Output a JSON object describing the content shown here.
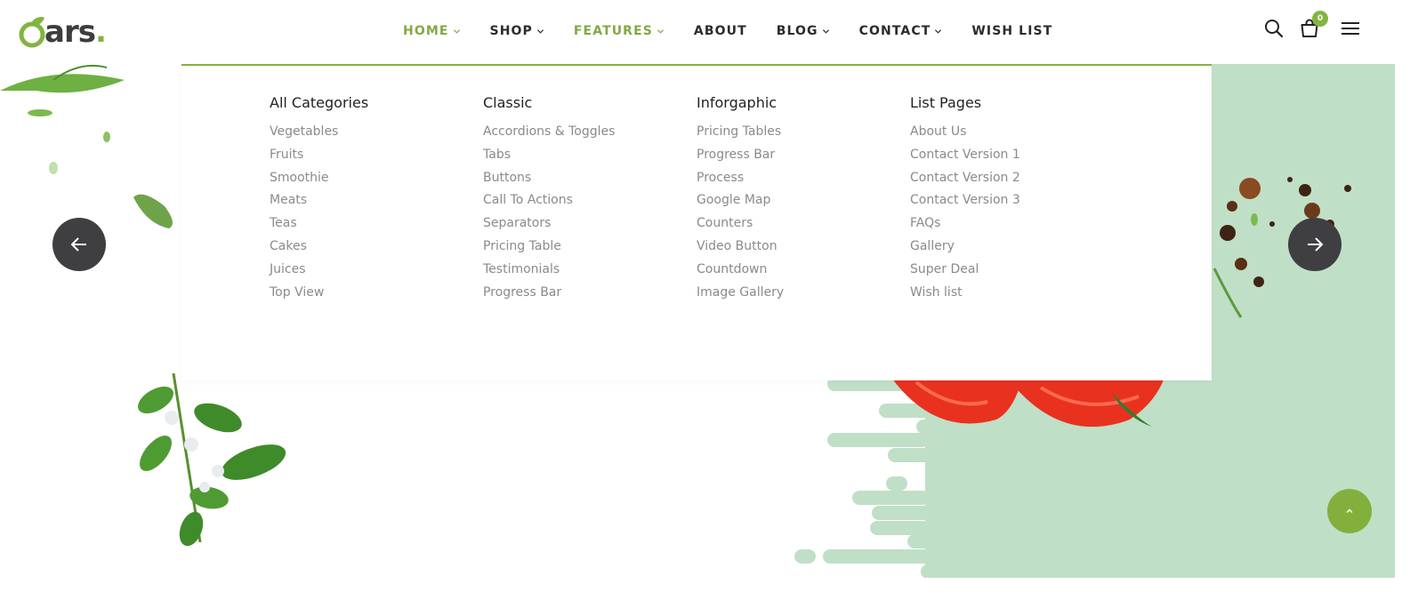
{
  "logo": {
    "text": "ars",
    "dot": "."
  },
  "nav": [
    {
      "label": "HOME",
      "dropdown": true,
      "active": true
    },
    {
      "label": "SHOP",
      "dropdown": true,
      "active": false
    },
    {
      "label": "FEATURES",
      "dropdown": true,
      "active": true
    },
    {
      "label": "ABOUT",
      "dropdown": false,
      "active": false
    },
    {
      "label": "BLOG",
      "dropdown": true,
      "active": false
    },
    {
      "label": "CONTACT",
      "dropdown": true,
      "active": false
    },
    {
      "label": "WISH LIST",
      "dropdown": false,
      "active": false
    }
  ],
  "header_icons": {
    "search": "search-icon",
    "cart": "shopping-bag-icon",
    "menu": "hamburger-menu-icon",
    "cart_count": "0"
  },
  "mega_menu": {
    "columns": [
      {
        "title": "All Categories",
        "links": [
          "Vegetables",
          "Fruits",
          "Smoothie",
          "Meats",
          "Teas",
          "Cakes",
          "Juices",
          "Top View"
        ]
      },
      {
        "title": "Classic",
        "links": [
          "Accordions & Toggles",
          "Tabs",
          "Buttons",
          "Call To Actions",
          "Separators",
          "Pricing Table",
          "Testimonials",
          "Progress Bar"
        ]
      },
      {
        "title": "Inforgaphic",
        "links": [
          "Pricing Tables",
          "Progress Bar",
          "Process",
          "Google Map",
          "Counters",
          "Video Button",
          "Countdown",
          "Image Gallery"
        ]
      },
      {
        "title": "List Pages",
        "links": [
          "About Us",
          "Contact Version 1",
          "Contact Version 2",
          "Contact Version 3",
          "FAQs",
          "Gallery",
          "Super Deal",
          "Wish list"
        ]
      }
    ]
  },
  "slider": {
    "prev_icon": "arrow-left-icon",
    "next_icon": "arrow-right-icon"
  },
  "scroll_top_icon": "chevron-up-icon",
  "colors": {
    "accent": "#82b440",
    "nav_active": "#82a844",
    "panel": "#c0dfc7",
    "arrow_bg": "#3f3f42"
  }
}
